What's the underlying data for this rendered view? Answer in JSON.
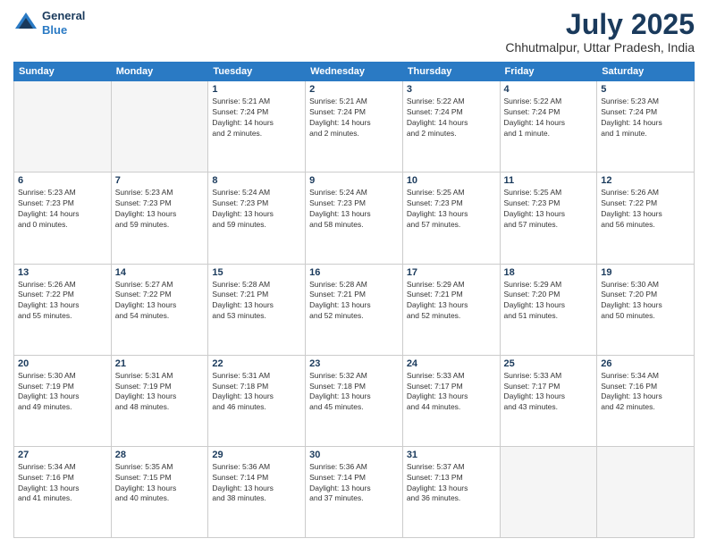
{
  "header": {
    "logo_line1": "General",
    "logo_line2": "Blue",
    "month": "July 2025",
    "location": "Chhutmalpur, Uttar Pradesh, India"
  },
  "weekdays": [
    "Sunday",
    "Monday",
    "Tuesday",
    "Wednesday",
    "Thursday",
    "Friday",
    "Saturday"
  ],
  "weeks": [
    [
      {
        "day": "",
        "text": ""
      },
      {
        "day": "",
        "text": ""
      },
      {
        "day": "1",
        "text": "Sunrise: 5:21 AM\nSunset: 7:24 PM\nDaylight: 14 hours\nand 2 minutes."
      },
      {
        "day": "2",
        "text": "Sunrise: 5:21 AM\nSunset: 7:24 PM\nDaylight: 14 hours\nand 2 minutes."
      },
      {
        "day": "3",
        "text": "Sunrise: 5:22 AM\nSunset: 7:24 PM\nDaylight: 14 hours\nand 2 minutes."
      },
      {
        "day": "4",
        "text": "Sunrise: 5:22 AM\nSunset: 7:24 PM\nDaylight: 14 hours\nand 1 minute."
      },
      {
        "day": "5",
        "text": "Sunrise: 5:23 AM\nSunset: 7:24 PM\nDaylight: 14 hours\nand 1 minute."
      }
    ],
    [
      {
        "day": "6",
        "text": "Sunrise: 5:23 AM\nSunset: 7:23 PM\nDaylight: 14 hours\nand 0 minutes."
      },
      {
        "day": "7",
        "text": "Sunrise: 5:23 AM\nSunset: 7:23 PM\nDaylight: 13 hours\nand 59 minutes."
      },
      {
        "day": "8",
        "text": "Sunrise: 5:24 AM\nSunset: 7:23 PM\nDaylight: 13 hours\nand 59 minutes."
      },
      {
        "day": "9",
        "text": "Sunrise: 5:24 AM\nSunset: 7:23 PM\nDaylight: 13 hours\nand 58 minutes."
      },
      {
        "day": "10",
        "text": "Sunrise: 5:25 AM\nSunset: 7:23 PM\nDaylight: 13 hours\nand 57 minutes."
      },
      {
        "day": "11",
        "text": "Sunrise: 5:25 AM\nSunset: 7:23 PM\nDaylight: 13 hours\nand 57 minutes."
      },
      {
        "day": "12",
        "text": "Sunrise: 5:26 AM\nSunset: 7:22 PM\nDaylight: 13 hours\nand 56 minutes."
      }
    ],
    [
      {
        "day": "13",
        "text": "Sunrise: 5:26 AM\nSunset: 7:22 PM\nDaylight: 13 hours\nand 55 minutes."
      },
      {
        "day": "14",
        "text": "Sunrise: 5:27 AM\nSunset: 7:22 PM\nDaylight: 13 hours\nand 54 minutes."
      },
      {
        "day": "15",
        "text": "Sunrise: 5:28 AM\nSunset: 7:21 PM\nDaylight: 13 hours\nand 53 minutes."
      },
      {
        "day": "16",
        "text": "Sunrise: 5:28 AM\nSunset: 7:21 PM\nDaylight: 13 hours\nand 52 minutes."
      },
      {
        "day": "17",
        "text": "Sunrise: 5:29 AM\nSunset: 7:21 PM\nDaylight: 13 hours\nand 52 minutes."
      },
      {
        "day": "18",
        "text": "Sunrise: 5:29 AM\nSunset: 7:20 PM\nDaylight: 13 hours\nand 51 minutes."
      },
      {
        "day": "19",
        "text": "Sunrise: 5:30 AM\nSunset: 7:20 PM\nDaylight: 13 hours\nand 50 minutes."
      }
    ],
    [
      {
        "day": "20",
        "text": "Sunrise: 5:30 AM\nSunset: 7:19 PM\nDaylight: 13 hours\nand 49 minutes."
      },
      {
        "day": "21",
        "text": "Sunrise: 5:31 AM\nSunset: 7:19 PM\nDaylight: 13 hours\nand 48 minutes."
      },
      {
        "day": "22",
        "text": "Sunrise: 5:31 AM\nSunset: 7:18 PM\nDaylight: 13 hours\nand 46 minutes."
      },
      {
        "day": "23",
        "text": "Sunrise: 5:32 AM\nSunset: 7:18 PM\nDaylight: 13 hours\nand 45 minutes."
      },
      {
        "day": "24",
        "text": "Sunrise: 5:33 AM\nSunset: 7:17 PM\nDaylight: 13 hours\nand 44 minutes."
      },
      {
        "day": "25",
        "text": "Sunrise: 5:33 AM\nSunset: 7:17 PM\nDaylight: 13 hours\nand 43 minutes."
      },
      {
        "day": "26",
        "text": "Sunrise: 5:34 AM\nSunset: 7:16 PM\nDaylight: 13 hours\nand 42 minutes."
      }
    ],
    [
      {
        "day": "27",
        "text": "Sunrise: 5:34 AM\nSunset: 7:16 PM\nDaylight: 13 hours\nand 41 minutes."
      },
      {
        "day": "28",
        "text": "Sunrise: 5:35 AM\nSunset: 7:15 PM\nDaylight: 13 hours\nand 40 minutes."
      },
      {
        "day": "29",
        "text": "Sunrise: 5:36 AM\nSunset: 7:14 PM\nDaylight: 13 hours\nand 38 minutes."
      },
      {
        "day": "30",
        "text": "Sunrise: 5:36 AM\nSunset: 7:14 PM\nDaylight: 13 hours\nand 37 minutes."
      },
      {
        "day": "31",
        "text": "Sunrise: 5:37 AM\nSunset: 7:13 PM\nDaylight: 13 hours\nand 36 minutes."
      },
      {
        "day": "",
        "text": ""
      },
      {
        "day": "",
        "text": ""
      }
    ]
  ]
}
